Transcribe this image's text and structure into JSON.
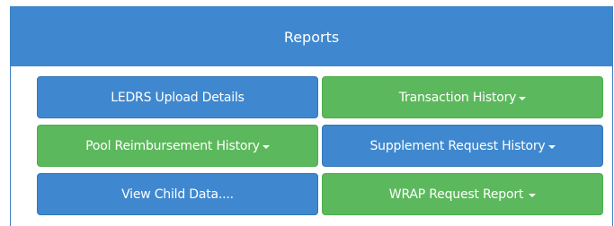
{
  "panel": {
    "title": "Reports"
  },
  "buttons": {
    "ledrs_upload": {
      "label": "LEDRS Upload Details",
      "color": "#3f88cf"
    },
    "transaction_history": {
      "label": "Transaction History",
      "color": "#5cb85c",
      "icon": "caret-down-icon"
    },
    "pool_reimbursement": {
      "label": "Pool Reimbursement History",
      "color": "#5cb85c",
      "icon": "caret-down-icon"
    },
    "supplement_request": {
      "label": "Supplement Request History",
      "color": "#3f88cf",
      "icon": "caret-down-icon"
    },
    "view_child_data": {
      "label": "View Child Data....",
      "color": "#3f88cf"
    },
    "wrap_request": {
      "label": "WRAP Request Report",
      "color": "#5cb85c",
      "icon": "caret-down-icon"
    }
  }
}
